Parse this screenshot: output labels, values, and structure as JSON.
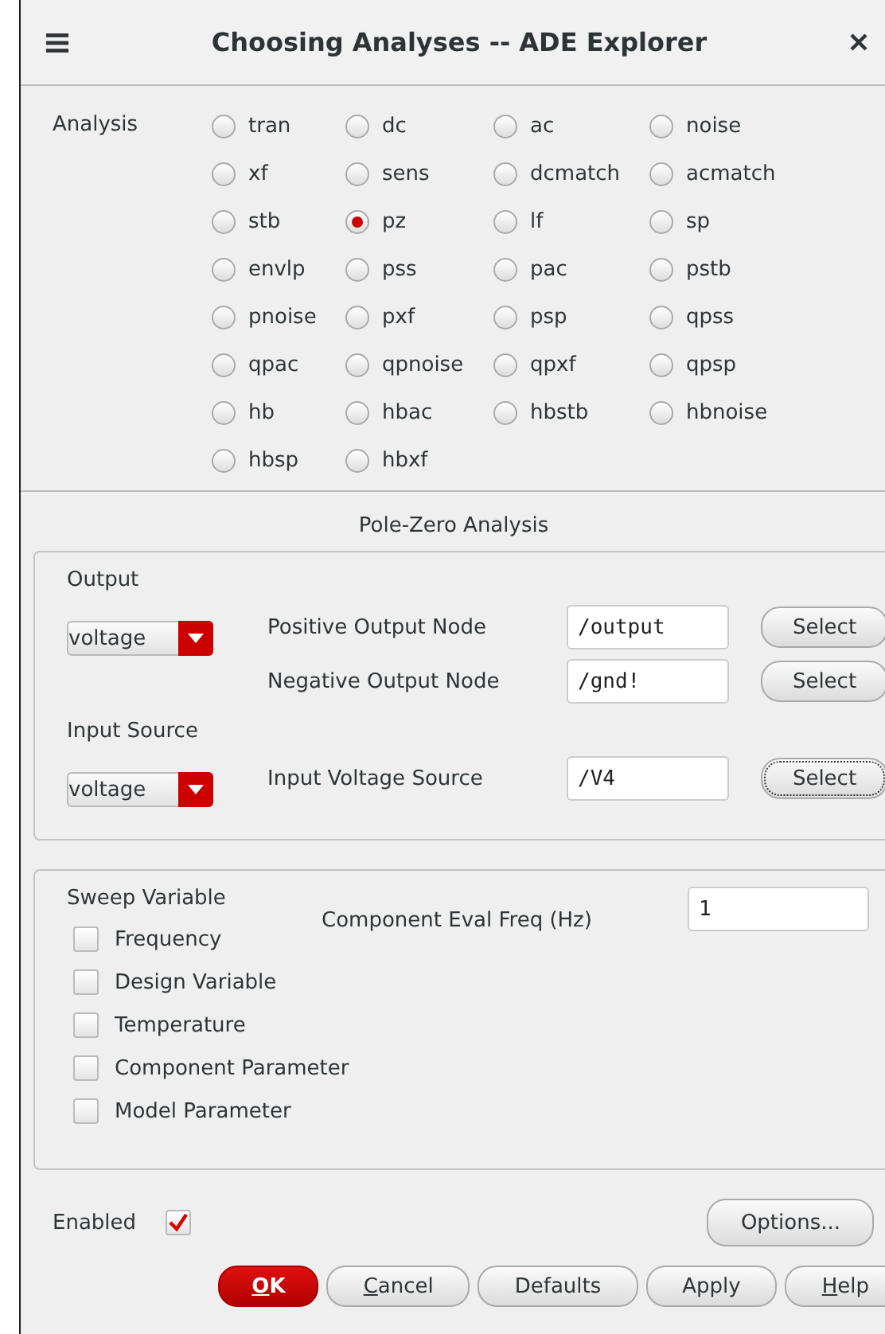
{
  "window": {
    "title": "Choosing Analyses -- ADE Explorer"
  },
  "analysis": {
    "label": "Analysis",
    "options": [
      {
        "label": "tran",
        "selected": false
      },
      {
        "label": "dc",
        "selected": false
      },
      {
        "label": "ac",
        "selected": false
      },
      {
        "label": "noise",
        "selected": false
      },
      {
        "label": "xf",
        "selected": false
      },
      {
        "label": "sens",
        "selected": false
      },
      {
        "label": "dcmatch",
        "selected": false
      },
      {
        "label": "acmatch",
        "selected": false
      },
      {
        "label": "stb",
        "selected": false
      },
      {
        "label": "pz",
        "selected": true
      },
      {
        "label": "lf",
        "selected": false
      },
      {
        "label": "sp",
        "selected": false
      },
      {
        "label": "envlp",
        "selected": false
      },
      {
        "label": "pss",
        "selected": false
      },
      {
        "label": "pac",
        "selected": false
      },
      {
        "label": "pstb",
        "selected": false
      },
      {
        "label": "pnoise",
        "selected": false
      },
      {
        "label": "pxf",
        "selected": false
      },
      {
        "label": "psp",
        "selected": false
      },
      {
        "label": "qpss",
        "selected": false
      },
      {
        "label": "qpac",
        "selected": false
      },
      {
        "label": "qpnoise",
        "selected": false
      },
      {
        "label": "qpxf",
        "selected": false
      },
      {
        "label": "qpsp",
        "selected": false
      },
      {
        "label": "hb",
        "selected": false
      },
      {
        "label": "hbac",
        "selected": false
      },
      {
        "label": "hbstb",
        "selected": false
      },
      {
        "label": "hbnoise",
        "selected": false
      },
      {
        "label": "hbsp",
        "selected": false
      },
      {
        "label": "hbxf",
        "selected": false
      }
    ]
  },
  "section_title": "Pole-Zero Analysis",
  "groups": [
    {
      "label": "Output",
      "type_select": "voltage",
      "nodes": [
        {
          "label": "Positive Output Node",
          "value": "/output",
          "button": "Select",
          "focused": false
        },
        {
          "label": "Negative Output Node",
          "value": "/gnd!",
          "button": "Select",
          "focused": false
        }
      ]
    },
    {
      "label": "Input Source",
      "type_select": "voltage",
      "nodes": [
        {
          "label": "Input Voltage Source",
          "value": "/V4",
          "button": "Select",
          "focused": true
        }
      ]
    }
  ],
  "sweep": {
    "label": "Sweep Variable",
    "eval_label": "Component Eval Freq (Hz)",
    "eval_value": "1",
    "variables": [
      {
        "label": "Frequency",
        "checked": false
      },
      {
        "label": "Design Variable",
        "checked": false
      },
      {
        "label": "Temperature",
        "checked": false
      },
      {
        "label": "Component Parameter",
        "checked": false
      },
      {
        "label": "Model Parameter",
        "checked": false
      }
    ]
  },
  "enabled": {
    "label": "Enabled",
    "checked": true
  },
  "options_button": "Options...",
  "buttons": [
    {
      "label": "OK",
      "kind": "primary",
      "mnemonic": true
    },
    {
      "label": "Cancel",
      "kind": "normal",
      "mnemonic": true
    },
    {
      "label": "Defaults",
      "kind": "normal",
      "mnemonic": false
    },
    {
      "label": "Apply",
      "kind": "normal",
      "mnemonic": false
    },
    {
      "label": "Help",
      "kind": "normal",
      "mnemonic": true
    }
  ]
}
